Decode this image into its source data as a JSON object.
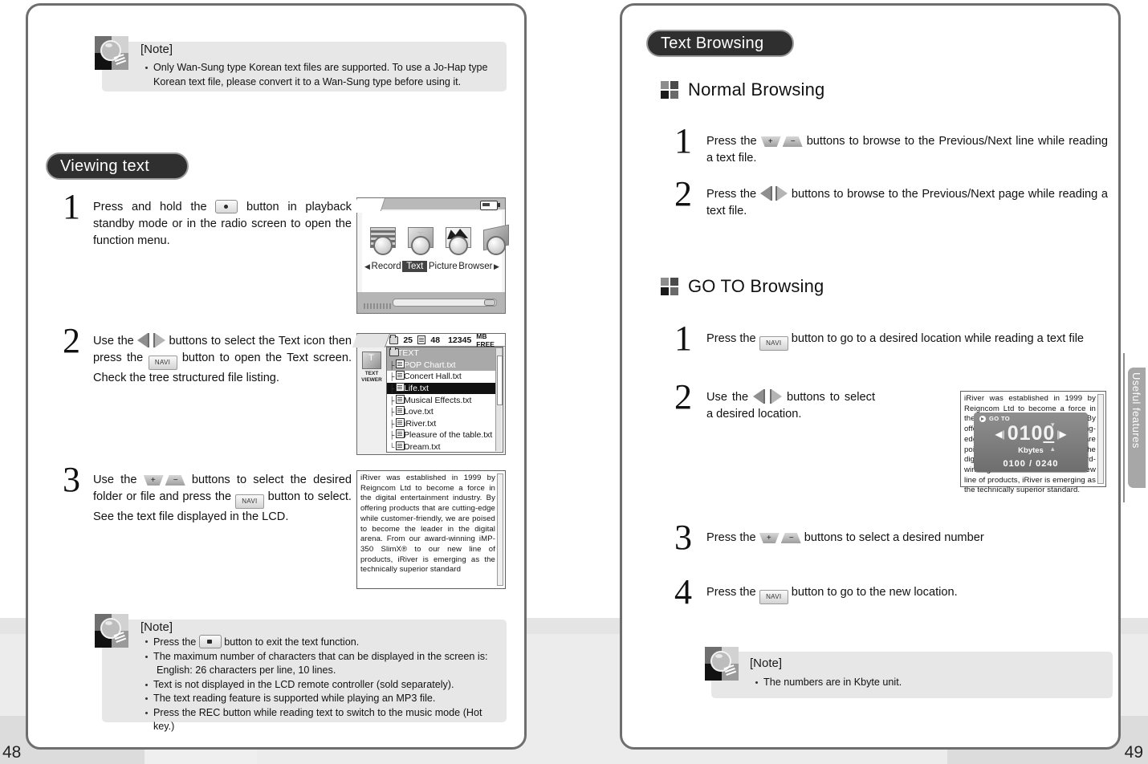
{
  "left_page": {
    "number": "48",
    "top_note": {
      "title": "[Note]",
      "items": [
        "Only Wan-Sung type Korean text files are supported. To use a Jo-Hap type Korean text file, please convert it to a Wan-Sung type before using it."
      ]
    },
    "section_title": "Viewing text",
    "steps": [
      {
        "num": "1",
        "parts_a": "Press and hold the",
        "key": "dot-button",
        "parts_b": "button in playback standby mode or in the radio screen to open the function menu."
      },
      {
        "num": "2",
        "parts_a": "Use the",
        "key": "prev-next-buttons",
        "parts_b": "buttons to select the Text icon then press the",
        "key2": "NAVI",
        "parts_c": "button to open the Text screen. Check the tree structured file listing."
      },
      {
        "num": "3",
        "parts_a": "Use the",
        "key": "volume-buttons",
        "parts_b": "buttons to select the desired folder or file and press the",
        "key2": "NAVI",
        "parts_c": "button to select. See the text file displayed in the LCD."
      }
    ],
    "bottom_note": {
      "title": "[Note]",
      "items": [
        {
          "pre": "Press the",
          "key": "rec-button",
          "post": "button to exit the text function."
        },
        {
          "pre": "The maximum number of characters that can be displayed in the screen is:",
          "sub": "English: 26 characters per line, 10 lines."
        },
        {
          "pre": "Text is not displayed in the LCD remote controller (sold separately)."
        },
        {
          "pre": "The text reading feature is supported while playing an MP3 file."
        },
        {
          "pre": "Press the REC button while reading text to switch to the music mode (Hot key.)"
        }
      ]
    },
    "menu_screen": {
      "labels": [
        "Record",
        "Text",
        "Picture",
        "Browser"
      ],
      "selected": "Text",
      "left_arrow": "◀",
      "right_arrow": "▶",
      "battery": "battery-icon"
    },
    "list_screen": {
      "header": {
        "folders": "25",
        "files": "48",
        "free": "12345",
        "free_unit": "MB FREE"
      },
      "side_badge": [
        "TEXT",
        "VIEWER"
      ],
      "rows": [
        {
          "name": "TEXT",
          "type": "folder",
          "state": "selected-gray",
          "indent": 0
        },
        {
          "name": "POP  Chart.txt",
          "type": "file",
          "state": "selected-gray",
          "indent": 1
        },
        {
          "name": "Concert  Hall.txt",
          "type": "file",
          "state": "normal",
          "indent": 1
        },
        {
          "name": "Life.txt",
          "type": "file",
          "state": "selected-black",
          "indent": 1
        },
        {
          "name": "Musical  Effects.txt",
          "type": "file",
          "state": "normal",
          "indent": 1
        },
        {
          "name": "Love.txt",
          "type": "file",
          "state": "normal",
          "indent": 1
        },
        {
          "name": "iRiver.txt",
          "type": "file",
          "state": "normal",
          "indent": 1
        },
        {
          "name": "Pleasure  of  the  table.txt",
          "type": "file",
          "state": "normal",
          "indent": 1
        },
        {
          "name": "Dream.txt",
          "type": "file",
          "state": "normal",
          "indent": 1
        }
      ]
    },
    "text_viewer": "iRiver was established in 1999 by Reigncom Ltd to become a force in the digital entertainment industry. By offering products that are cutting-edge while customer-friendly, we are poised to become the leader in the digital arena. From our award-winning iMP-350 SlimX® to our new line of products, iRiver is emerging as the technically superior standard"
  },
  "right_page": {
    "number": "49",
    "section_title": "Text Browsing",
    "side_tab": "Useful features",
    "normal_browsing": {
      "heading": "Normal Browsing",
      "steps": [
        {
          "num": "1",
          "parts_a": "Press the",
          "key": "volume-buttons",
          "parts_b": "buttons to browse to the Previous/Next line while reading a text file."
        },
        {
          "num": "2",
          "parts_a": "Press the",
          "key": "prev-next-buttons",
          "parts_b": "buttons to browse to the Previous/Next page while reading a text file."
        }
      ]
    },
    "goto_browsing": {
      "heading": "GO TO Browsing",
      "steps": [
        {
          "num": "1",
          "parts_a": "Press the",
          "key": "NAVI",
          "parts_b": "button to go to a desired location while reading a text file"
        },
        {
          "num": "2",
          "parts_a": "Use the",
          "key": "prev-next-buttons",
          "parts_b": "buttons to select a desired location."
        },
        {
          "num": "3",
          "parts_a": "Press the",
          "key": "volume-buttons",
          "parts_b": "buttons to select a desired number"
        },
        {
          "num": "4",
          "parts_a": "Press the",
          "key": "NAVI",
          "parts_b": "button to go to the new location."
        }
      ]
    },
    "goto_dialog": {
      "title": "GO TO",
      "value": "0100",
      "unit": "Kbytes",
      "ratio": "0100 / 0240",
      "left_arrow": "◀|",
      "right_arrow": "|▶"
    },
    "text_viewer": "iRiver was established in 1999 by Reigncom Ltd to become a force in the digital entertainment industry. By offering products that are cutting-edge while customer-friendly, we are poised to become the leader in the digital arena. From our award-winning iMP-350 SlimX® to our new line of products, iRiver is emerging as the technically superior standard.",
    "bottom_note": {
      "title": "[Note]",
      "items": [
        "The numbers are in Kbyte unit."
      ]
    }
  }
}
